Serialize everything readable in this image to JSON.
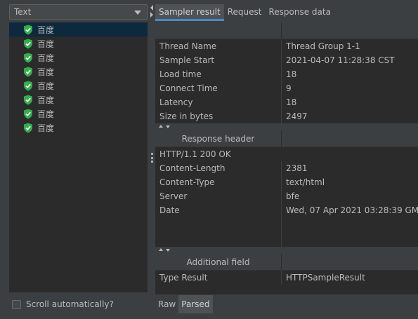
{
  "left": {
    "renderer": "Text",
    "tree_items": [
      {
        "label": "百度",
        "status": "success"
      },
      {
        "label": "百度",
        "status": "success"
      },
      {
        "label": "百度",
        "status": "success"
      },
      {
        "label": "百度",
        "status": "success"
      },
      {
        "label": "百度",
        "status": "success"
      },
      {
        "label": "百度",
        "status": "success"
      },
      {
        "label": "百度",
        "status": "success"
      },
      {
        "label": "百度",
        "status": "success"
      }
    ],
    "scroll_auto_label": "Scroll automatically?"
  },
  "tabs": [
    "Sampler result",
    "Request",
    "Response data"
  ],
  "sampler": [
    {
      "name": "Thread Name",
      "value": "Thread Group 1-1"
    },
    {
      "name": "Sample Start",
      "value": "2021-04-07 11:28:38 CST"
    },
    {
      "name": "Load time",
      "value": "18"
    },
    {
      "name": "Connect Time",
      "value": "9"
    },
    {
      "name": "Latency",
      "value": "18"
    },
    {
      "name": "Size in bytes",
      "value": "2497"
    }
  ],
  "response_header": {
    "title": "Response header",
    "status_line": "HTTP/1.1 200 OK",
    "rows": [
      {
        "name": "Content-Length",
        "value": "2381"
      },
      {
        "name": "Content-Type",
        "value": "text/html"
      },
      {
        "name": "Server",
        "value": "bfe"
      },
      {
        "name": "Date",
        "value": "Wed, 07 Apr 2021 03:28:39 GMT"
      }
    ]
  },
  "additional": {
    "title": "Additional field",
    "rows": [
      {
        "name": "Type Result",
        "value": "HTTPSampleResult"
      }
    ]
  },
  "bottom_tabs": [
    "Raw",
    "Parsed"
  ],
  "colors": {
    "success": "#2fb14a",
    "tab_accent": "#4a88c7"
  }
}
